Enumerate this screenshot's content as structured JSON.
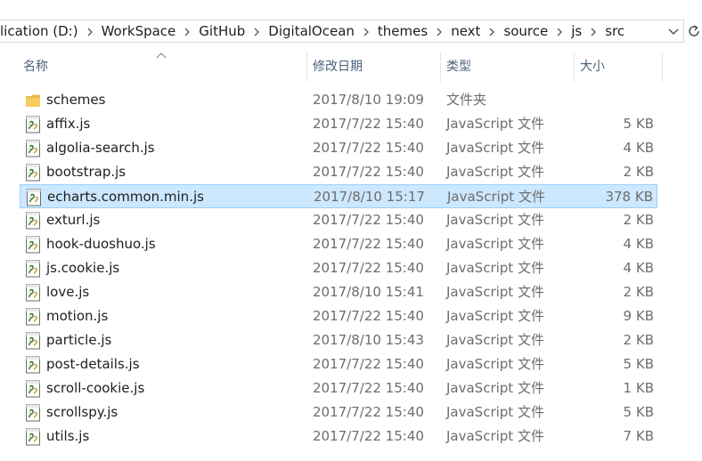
{
  "address": {
    "crumbs": [
      "lication (D:)",
      "WorkSpace",
      "GitHub",
      "DigitalOcean",
      "themes",
      "next",
      "source",
      "js",
      "src"
    ]
  },
  "columns": {
    "name": "名称",
    "date": "修改日期",
    "type": "类型",
    "size": "大小"
  },
  "files": [
    {
      "name": "schemes",
      "date": "2017/8/10 19:09",
      "type": "文件夹",
      "size": "",
      "icon": "folder-icon",
      "selected": false
    },
    {
      "name": "affix.js",
      "date": "2017/7/22 15:40",
      "type": "JavaScript 文件",
      "size": "5 KB",
      "icon": "js-file-icon",
      "selected": false
    },
    {
      "name": "algolia-search.js",
      "date": "2017/7/22 15:40",
      "type": "JavaScript 文件",
      "size": "4 KB",
      "icon": "js-file-icon",
      "selected": false
    },
    {
      "name": "bootstrap.js",
      "date": "2017/7/22 15:40",
      "type": "JavaScript 文件",
      "size": "2 KB",
      "icon": "js-file-icon",
      "selected": false
    },
    {
      "name": "echarts.common.min.js",
      "date": "2017/8/10 15:17",
      "type": "JavaScript 文件",
      "size": "378 KB",
      "icon": "js-file-icon",
      "selected": true
    },
    {
      "name": "exturl.js",
      "date": "2017/7/22 15:40",
      "type": "JavaScript 文件",
      "size": "2 KB",
      "icon": "js-file-icon",
      "selected": false
    },
    {
      "name": "hook-duoshuo.js",
      "date": "2017/7/22 15:40",
      "type": "JavaScript 文件",
      "size": "4 KB",
      "icon": "js-file-icon",
      "selected": false
    },
    {
      "name": "js.cookie.js",
      "date": "2017/7/22 15:40",
      "type": "JavaScript 文件",
      "size": "4 KB",
      "icon": "js-file-icon",
      "selected": false
    },
    {
      "name": "love.js",
      "date": "2017/8/10 15:41",
      "type": "JavaScript 文件",
      "size": "2 KB",
      "icon": "js-file-icon",
      "selected": false
    },
    {
      "name": "motion.js",
      "date": "2017/7/22 15:40",
      "type": "JavaScript 文件",
      "size": "9 KB",
      "icon": "js-file-icon",
      "selected": false
    },
    {
      "name": "particle.js",
      "date": "2017/8/10 15:43",
      "type": "JavaScript 文件",
      "size": "2 KB",
      "icon": "js-file-icon",
      "selected": false
    },
    {
      "name": "post-details.js",
      "date": "2017/7/22 15:40",
      "type": "JavaScript 文件",
      "size": "5 KB",
      "icon": "js-file-icon",
      "selected": false
    },
    {
      "name": "scroll-cookie.js",
      "date": "2017/7/22 15:40",
      "type": "JavaScript 文件",
      "size": "1 KB",
      "icon": "js-file-icon",
      "selected": false
    },
    {
      "name": "scrollspy.js",
      "date": "2017/7/22 15:40",
      "type": "JavaScript 文件",
      "size": "5 KB",
      "icon": "js-file-icon",
      "selected": false
    },
    {
      "name": "utils.js",
      "date": "2017/7/22 15:40",
      "type": "JavaScript 文件",
      "size": "7 KB",
      "icon": "js-file-icon",
      "selected": false
    }
  ],
  "colors": {
    "selected_bg": "#cce8ff",
    "selected_border": "#99d1ff",
    "header_text": "#4c607a",
    "secondary_text": "#6d6d6d"
  }
}
